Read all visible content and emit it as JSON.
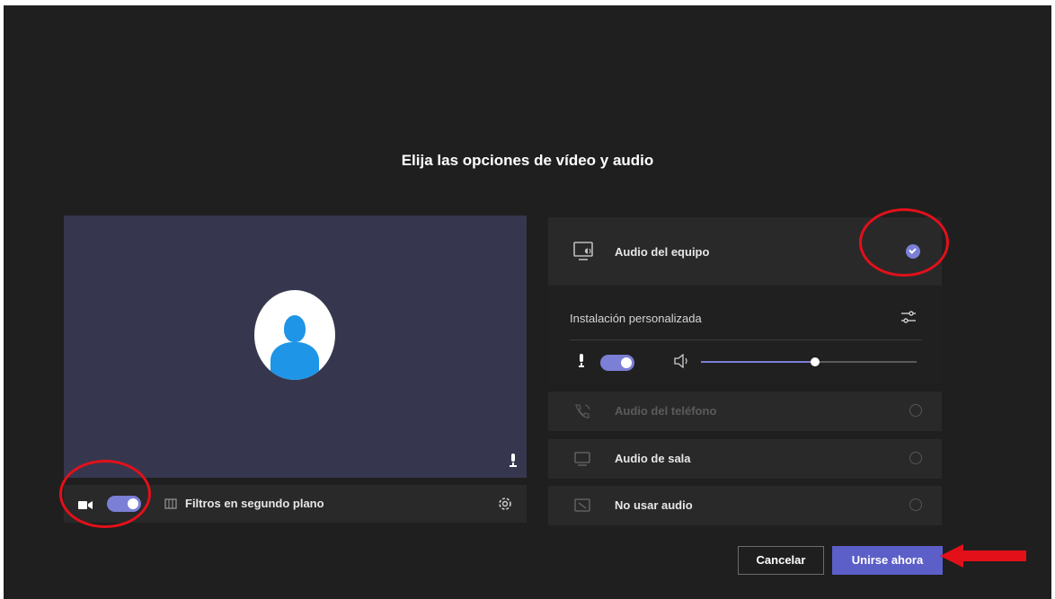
{
  "dialog": {
    "title": "Elija las opciones de vídeo y audio"
  },
  "video": {
    "camera_on": true,
    "filters_label": "Filtros en segundo plano"
  },
  "audio_options": {
    "computer": {
      "label": "Audio del equipo",
      "selected": true
    },
    "custom_setup_label": "Instalación personalizada",
    "mic_on": true,
    "volume_level": 0.53,
    "phone": {
      "label": "Audio del teléfono",
      "selected": false,
      "disabled": true
    },
    "room": {
      "label": "Audio de sala",
      "selected": false
    },
    "none": {
      "label": "No usar audio",
      "selected": false
    }
  },
  "buttons": {
    "cancel": "Cancelar",
    "join": "Unirse ahora"
  },
  "colors": {
    "accent": "#5b5fc7",
    "toggle_on": "#7b7fd6",
    "annotation_red": "#e3101a",
    "background": "#1f1f1f"
  },
  "icons": [
    "camera-icon",
    "background-filter-icon",
    "gear-icon",
    "computer-audio-icon",
    "sliders-icon",
    "microphone-icon",
    "speaker-icon",
    "phone-icon",
    "room-audio-icon",
    "no-audio-icon",
    "avatar-icon"
  ]
}
